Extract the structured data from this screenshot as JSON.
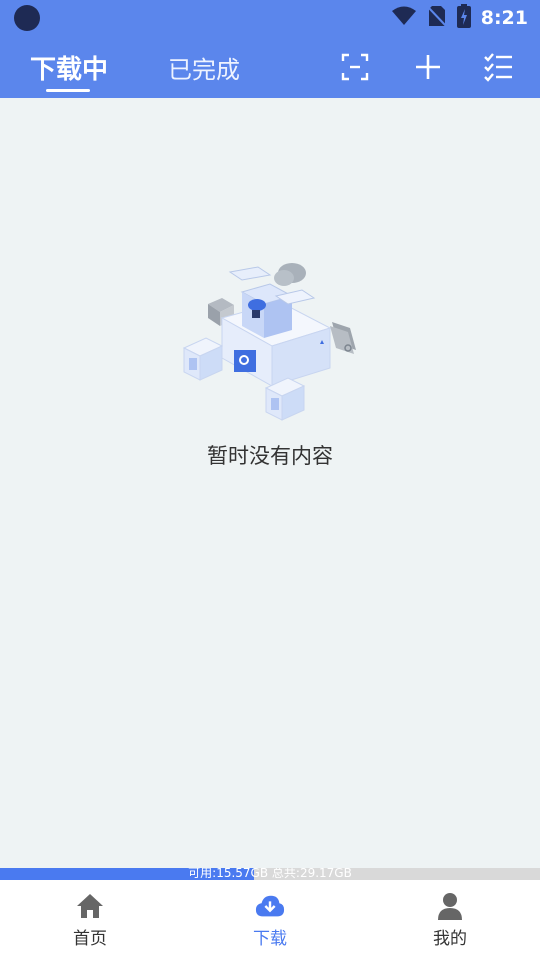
{
  "status_bar": {
    "time": "8:21"
  },
  "tabs": [
    {
      "label": "下载中",
      "active": true
    },
    {
      "label": "已完成",
      "active": false
    }
  ],
  "toolbar": {
    "icons": [
      "scan-icon",
      "plus-icon",
      "checklist-icon"
    ]
  },
  "empty_state": {
    "message": "暂时没有内容"
  },
  "storage": {
    "text": "可用:15.57GB 总共:29.17GB",
    "used_fraction": 0.47
  },
  "bottom_nav": [
    {
      "label": "首页",
      "icon": "home-icon",
      "active": false
    },
    {
      "label": "下载",
      "icon": "cloud-download-icon",
      "active": true
    },
    {
      "label": "我的",
      "icon": "user-icon",
      "active": false
    }
  ],
  "colors": {
    "primary": "#5b86ec",
    "accent": "#4a7af0",
    "background": "#eef3f4"
  }
}
